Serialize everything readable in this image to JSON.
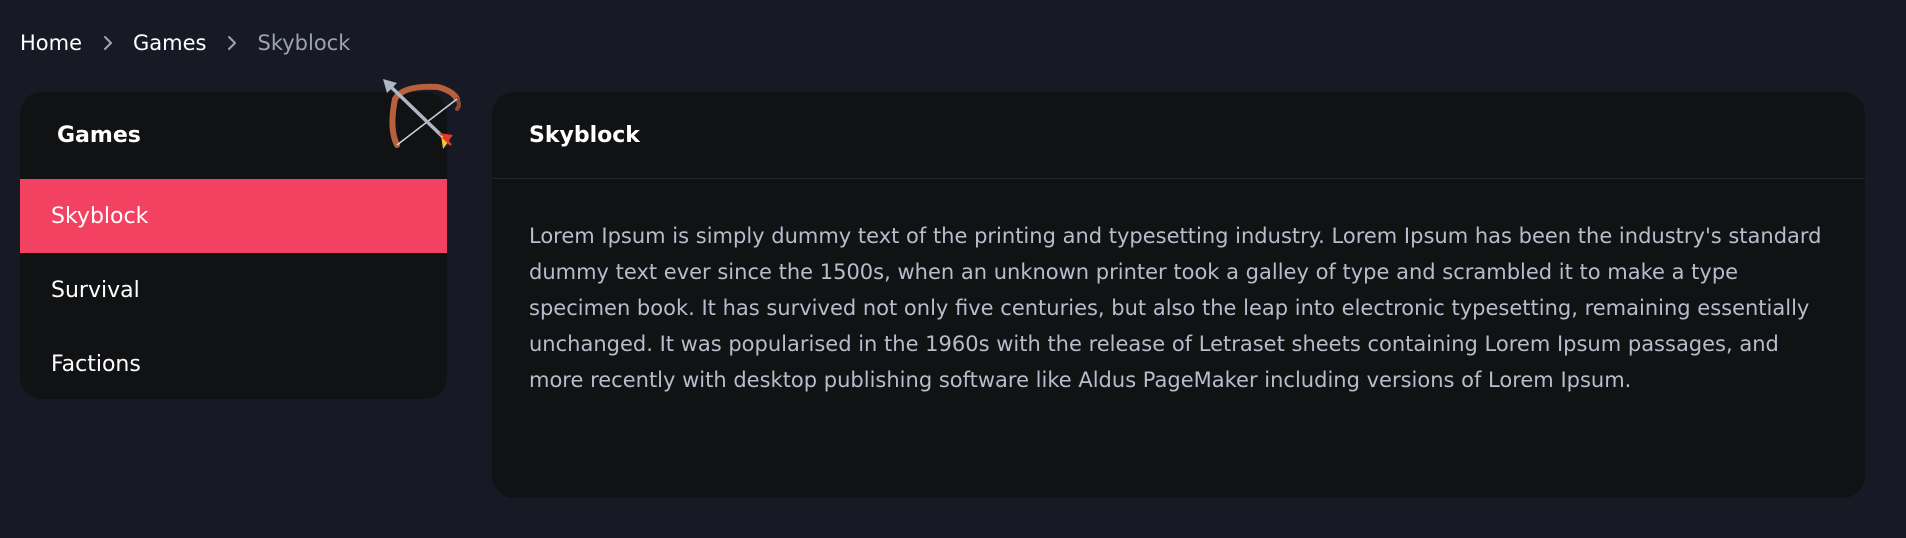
{
  "breadcrumb": {
    "items": [
      {
        "label": "Home"
      },
      {
        "label": "Games"
      },
      {
        "label": "Skyblock"
      }
    ],
    "separator_icon": "chevron-right-icon"
  },
  "sidebar": {
    "title": "Games",
    "decoration_icon": "bow-and-arrow-icon",
    "items": [
      {
        "label": "Skyblock",
        "active": true
      },
      {
        "label": "Survival",
        "active": false
      },
      {
        "label": "Factions",
        "active": false
      }
    ]
  },
  "main": {
    "title": "Skyblock",
    "body": "Lorem Ipsum is simply dummy text of the printing and typesetting industry. Lorem Ipsum has been the industry's standard dummy text ever since the 1500s, when an unknown printer took a galley of type and scrambled it to make a type specimen book. It has survived not only five centuries, but also the leap into electronic typesetting, remaining essentially unchanged. It was popularised in the 1960s with the release of Letraset sheets containing Lorem Ipsum passages, and more recently with desktop publishing software like Aldus PageMaker including versions of Lorem Ipsum."
  },
  "colors": {
    "page_background": "#171a24",
    "panel_background": "#111214",
    "accent": "#f34162",
    "muted_text": "#b8bccb",
    "breadcrumb_current": "#9ea3b4"
  }
}
